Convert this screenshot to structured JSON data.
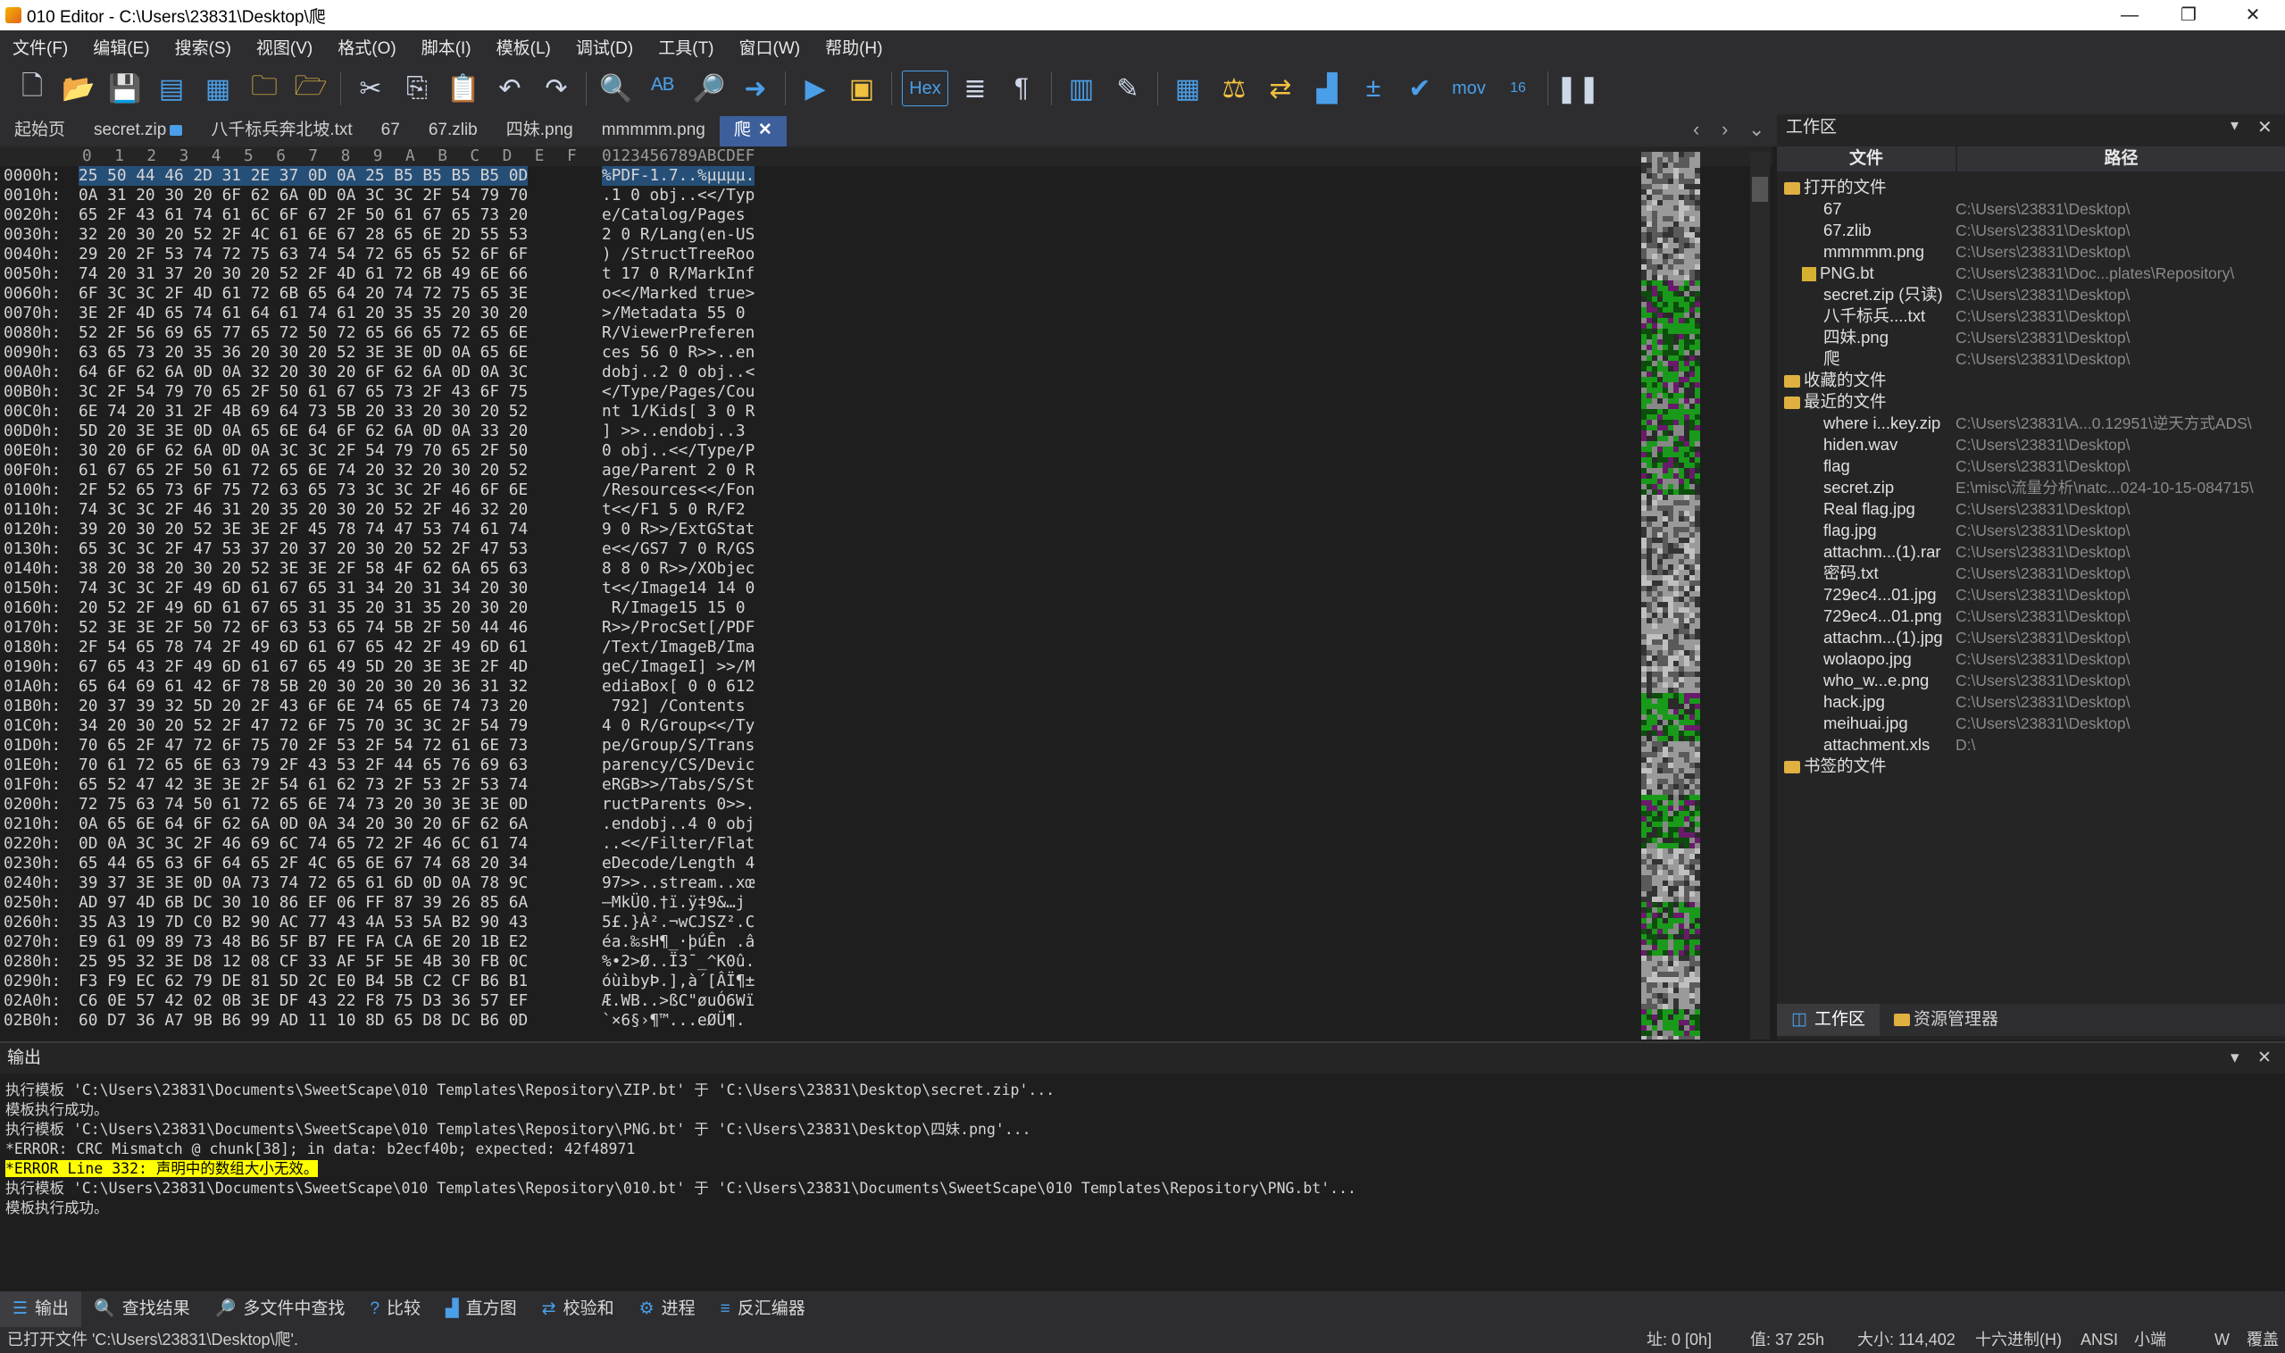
{
  "window": {
    "title": "010 Editor - C:\\Users\\23831\\Desktop\\爬",
    "min": "—",
    "max": "❐",
    "close": "✕"
  },
  "menu": [
    "文件(F)",
    "编辑(E)",
    "搜索(S)",
    "视图(V)",
    "格式(O)",
    "脚本(I)",
    "模板(L)",
    "调试(D)",
    "工具(T)",
    "窗口(W)",
    "帮助(H)"
  ],
  "toolbar": {
    "hex_label": "Hex",
    "mov_label": "mov",
    "base_label": "16"
  },
  "tabs": [
    {
      "label": "起始页"
    },
    {
      "label": "secret.zip",
      "locked": true
    },
    {
      "label": "八千标兵奔北坡.txt"
    },
    {
      "label": "67"
    },
    {
      "label": "67.zlib"
    },
    {
      "label": "四妹.png"
    },
    {
      "label": "mmmmm.png"
    },
    {
      "label": "爬",
      "active": true
    }
  ],
  "tab_close": "✕",
  "tab_nav": {
    "left": "‹",
    "right": "›",
    "menu": "⌄"
  },
  "hex": {
    "columns": [
      "0",
      "1",
      "2",
      "3",
      "4",
      "5",
      "6",
      "7",
      "8",
      "9",
      "A",
      "B",
      "C",
      "D",
      "E",
      "F"
    ],
    "text_header": "0123456789ABCDEF",
    "rows": [
      {
        "addr": "0000h:",
        "bytes": "25 50 44 46 2D 31 2E 37 0D 0A 25 B5 B5 B5 B5 0D",
        "text": "%PDF-1.7..%µµµµ."
      },
      {
        "addr": "0010h:",
        "bytes": "0A 31 20 30 20 6F 62 6A 0D 0A 3C 3C 2F 54 79 70",
        "text": ".1 0 obj..<</Typ"
      },
      {
        "addr": "0020h:",
        "bytes": "65 2F 43 61 74 61 6C 6F 67 2F 50 61 67 65 73 20",
        "text": "e/Catalog/Pages "
      },
      {
        "addr": "0030h:",
        "bytes": "32 20 30 20 52 2F 4C 61 6E 67 28 65 6E 2D 55 53",
        "text": "2 0 R/Lang(en-US"
      },
      {
        "addr": "0040h:",
        "bytes": "29 20 2F 53 74 72 75 63 74 54 72 65 65 52 6F 6F",
        "text": ") /StructTreeRoo"
      },
      {
        "addr": "0050h:",
        "bytes": "74 20 31 37 20 30 20 52 2F 4D 61 72 6B 49 6E 66",
        "text": "t 17 0 R/MarkInf"
      },
      {
        "addr": "0060h:",
        "bytes": "6F 3C 3C 2F 4D 61 72 6B 65 64 20 74 72 75 65 3E",
        "text": "o<</Marked true>"
      },
      {
        "addr": "0070h:",
        "bytes": "3E 2F 4D 65 74 61 64 61 74 61 20 35 35 20 30 20",
        "text": ">/Metadata 55 0 "
      },
      {
        "addr": "0080h:",
        "bytes": "52 2F 56 69 65 77 65 72 50 72 65 66 65 72 65 6E",
        "text": "R/ViewerPreferen"
      },
      {
        "addr": "0090h:",
        "bytes": "63 65 73 20 35 36 20 30 20 52 3E 3E 0D 0A 65 6E",
        "text": "ces 56 0 R>>..en"
      },
      {
        "addr": "00A0h:",
        "bytes": "64 6F 62 6A 0D 0A 32 20 30 20 6F 62 6A 0D 0A 3C",
        "text": "dobj..2 0 obj..<"
      },
      {
        "addr": "00B0h:",
        "bytes": "3C 2F 54 79 70 65 2F 50 61 67 65 73 2F 43 6F 75",
        "text": "</Type/Pages/Cou"
      },
      {
        "addr": "00C0h:",
        "bytes": "6E 74 20 31 2F 4B 69 64 73 5B 20 33 20 30 20 52",
        "text": "nt 1/Kids[ 3 0 R"
      },
      {
        "addr": "00D0h:",
        "bytes": "5D 20 3E 3E 0D 0A 65 6E 64 6F 62 6A 0D 0A 33 20",
        "text": "] >>..endobj..3 "
      },
      {
        "addr": "00E0h:",
        "bytes": "30 20 6F 62 6A 0D 0A 3C 3C 2F 54 79 70 65 2F 50",
        "text": "0 obj..<</Type/P"
      },
      {
        "addr": "00F0h:",
        "bytes": "61 67 65 2F 50 61 72 65 6E 74 20 32 20 30 20 52",
        "text": "age/Parent 2 0 R"
      },
      {
        "addr": "0100h:",
        "bytes": "2F 52 65 73 6F 75 72 63 65 73 3C 3C 2F 46 6F 6E",
        "text": "/Resources<</Fon"
      },
      {
        "addr": "0110h:",
        "bytes": "74 3C 3C 2F 46 31 20 35 20 30 20 52 2F 46 32 20",
        "text": "t<</F1 5 0 R/F2 "
      },
      {
        "addr": "0120h:",
        "bytes": "39 20 30 20 52 3E 3E 2F 45 78 74 47 53 74 61 74",
        "text": "9 0 R>>/ExtGStat"
      },
      {
        "addr": "0130h:",
        "bytes": "65 3C 3C 2F 47 53 37 20 37 20 30 20 52 2F 47 53",
        "text": "e<</GS7 7 0 R/GS"
      },
      {
        "addr": "0140h:",
        "bytes": "38 20 38 20 30 20 52 3E 3E 2F 58 4F 62 6A 65 63",
        "text": "8 8 0 R>>/XObjec"
      },
      {
        "addr": "0150h:",
        "bytes": "74 3C 3C 2F 49 6D 61 67 65 31 34 20 31 34 20 30",
        "text": "t<</Image14 14 0"
      },
      {
        "addr": "0160h:",
        "bytes": "20 52 2F 49 6D 61 67 65 31 35 20 31 35 20 30 20",
        "text": " R/Image15 15 0 "
      },
      {
        "addr": "0170h:",
        "bytes": "52 3E 3E 2F 50 72 6F 63 53 65 74 5B 2F 50 44 46",
        "text": "R>>/ProcSet[/PDF"
      },
      {
        "addr": "0180h:",
        "bytes": "2F 54 65 78 74 2F 49 6D 61 67 65 42 2F 49 6D 61",
        "text": "/Text/ImageB/Ima"
      },
      {
        "addr": "0190h:",
        "bytes": "67 65 43 2F 49 6D 61 67 65 49 5D 20 3E 3E 2F 4D",
        "text": "geC/ImageI] >>/M"
      },
      {
        "addr": "01A0h:",
        "bytes": "65 64 69 61 42 6F 78 5B 20 30 20 30 20 36 31 32",
        "text": "ediaBox[ 0 0 612"
      },
      {
        "addr": "01B0h:",
        "bytes": "20 37 39 32 5D 20 2F 43 6F 6E 74 65 6E 74 73 20",
        "text": " 792] /Contents "
      },
      {
        "addr": "01C0h:",
        "bytes": "34 20 30 20 52 2F 47 72 6F 75 70 3C 3C 2F 54 79",
        "text": "4 0 R/Group<</Ty"
      },
      {
        "addr": "01D0h:",
        "bytes": "70 65 2F 47 72 6F 75 70 2F 53 2F 54 72 61 6E 73",
        "text": "pe/Group/S/Trans"
      },
      {
        "addr": "01E0h:",
        "bytes": "70 61 72 65 6E 63 79 2F 43 53 2F 44 65 76 69 63",
        "text": "parency/CS/Devic"
      },
      {
        "addr": "01F0h:",
        "bytes": "65 52 47 42 3E 3E 2F 54 61 62 73 2F 53 2F 53 74",
        "text": "eRGB>>/Tabs/S/St"
      },
      {
        "addr": "0200h:",
        "bytes": "72 75 63 74 50 61 72 65 6E 74 73 20 30 3E 3E 0D",
        "text": "ructParents 0>>."
      },
      {
        "addr": "0210h:",
        "bytes": "0A 65 6E 64 6F 62 6A 0D 0A 34 20 30 20 6F 62 6A",
        "text": ".endobj..4 0 obj"
      },
      {
        "addr": "0220h:",
        "bytes": "0D 0A 3C 3C 2F 46 69 6C 74 65 72 2F 46 6C 61 74",
        "text": "..<</Filter/Flat"
      },
      {
        "addr": "0230h:",
        "bytes": "65 44 65 63 6F 64 65 2F 4C 65 6E 67 74 68 20 34",
        "text": "eDecode/Length 4"
      },
      {
        "addr": "0240h:",
        "bytes": "39 37 3E 3E 0D 0A 73 74 72 65 61 6D 0D 0A 78 9C",
        "text": "97>>..stream..xœ"
      },
      {
        "addr": "0250h:",
        "bytes": "AD 97 4D 6B DC 30 10 86 EF 06 FF 87 39 26 85 6A",
        "text": "­—MkÜ0.†ï.ÿ‡9&…j"
      },
      {
        "addr": "0260h:",
        "bytes": "35 A3 19 7D C0 B2 90 AC 77 43 4A 53 5A B2 90 43",
        "text": "5£.}À².¬wCJSZ².C"
      },
      {
        "addr": "0270h:",
        "bytes": "E9 61 09 89 73 48 B6 5F B7 FE FA CA 6E 20 1B E2",
        "text": "éa.‰sH¶_·þúÊn .â"
      },
      {
        "addr": "0280h:",
        "bytes": "25 95 32 3E D8 12 08 CF 33 AF 5F 5E 4B 30 FB 0C",
        "text": "%•2>Ø..Ï3¯_^K0û."
      },
      {
        "addr": "0290h:",
        "bytes": "F3 F9 EC 62 79 DE 81 5D 2C E0 B4 5B C2 CF B6 B1",
        "text": "óùìbyÞ.],à´[ÂÏ¶±"
      },
      {
        "addr": "02A0h:",
        "bytes": "C6 0E 57 42 02 0B 3E DF 43 22 F8 75 D3 36 57 EF",
        "text": "Æ.WB..>ßC\"øuÓ6Wï"
      },
      {
        "addr": "02B0h:",
        "bytes": "60 D7 36 A7 9B B6 99 AD 11 10 8D 65 D8 DC B6 0D",
        "text": "`×6§›¶™­...eØÜ¶."
      }
    ]
  },
  "workspace": {
    "title": "工作区",
    "col_file": "文件",
    "col_path": "路径",
    "groups": [
      {
        "label": "打开的文件",
        "items": [
          {
            "name": "67",
            "path": "C:\\Users\\23831\\Desktop\\"
          },
          {
            "name": "67.zlib",
            "path": "C:\\Users\\23831\\Desktop\\"
          },
          {
            "name": "mmmmm.png",
            "path": "C:\\Users\\23831\\Desktop\\"
          },
          {
            "name": "PNG.bt",
            "path": "C:\\Users\\23831\\Doc...plates\\Repository\\",
            "template": true
          },
          {
            "name": "secret.zip (只读)",
            "path": "C:\\Users\\23831\\Desktop\\"
          },
          {
            "name": "八千标兵....txt",
            "path": "C:\\Users\\23831\\Desktop\\"
          },
          {
            "name": "四妹.png",
            "path": "C:\\Users\\23831\\Desktop\\"
          },
          {
            "name": "爬",
            "path": "C:\\Users\\23831\\Desktop\\"
          }
        ]
      },
      {
        "label": "收藏的文件",
        "items": []
      },
      {
        "label": "最近的文件",
        "items": [
          {
            "name": "where i...key.zip",
            "path": "C:\\Users\\23831\\A...0.12951\\逆天方式ADS\\"
          },
          {
            "name": "hiden.wav",
            "path": "C:\\Users\\23831\\Desktop\\"
          },
          {
            "name": "flag",
            "path": "C:\\Users\\23831\\Desktop\\"
          },
          {
            "name": "secret.zip",
            "path": "E:\\misc\\流量分析\\natc...024-10-15-084715\\"
          },
          {
            "name": "Real flag.jpg",
            "path": "C:\\Users\\23831\\Desktop\\"
          },
          {
            "name": "flag.jpg",
            "path": "C:\\Users\\23831\\Desktop\\"
          },
          {
            "name": "attachm...(1).rar",
            "path": "C:\\Users\\23831\\Desktop\\"
          },
          {
            "name": "密码.txt",
            "path": "C:\\Users\\23831\\Desktop\\"
          },
          {
            "name": "729ec4...01.jpg",
            "path": "C:\\Users\\23831\\Desktop\\"
          },
          {
            "name": "729ec4...01.png",
            "path": "C:\\Users\\23831\\Desktop\\"
          },
          {
            "name": "attachm...(1).jpg",
            "path": "C:\\Users\\23831\\Desktop\\"
          },
          {
            "name": "wolaopo.jpg",
            "path": "C:\\Users\\23831\\Desktop\\"
          },
          {
            "name": "who_w...e.png",
            "path": "C:\\Users\\23831\\Desktop\\"
          },
          {
            "name": "hack.jpg",
            "path": "C:\\Users\\23831\\Desktop\\"
          },
          {
            "name": "meihuai.jpg",
            "path": "C:\\Users\\23831\\Desktop\\"
          },
          {
            "name": "attachment.xls",
            "path": "D:\\"
          }
        ]
      },
      {
        "label": "书签的文件",
        "items": []
      }
    ],
    "tab_workspace": "工作区",
    "tab_explorer": "资源管理器"
  },
  "output": {
    "title": "输出",
    "lines": [
      {
        "text": "执行模板 'C:\\Users\\23831\\Documents\\SweetScape\\010 Templates\\Repository\\ZIP.bt' 于 'C:\\Users\\23831\\Desktop\\secret.zip'..."
      },
      {
        "text": "模板执行成功。"
      },
      {
        "text": "执行模板 'C:\\Users\\23831\\Documents\\SweetScape\\010 Templates\\Repository\\PNG.bt' 于 'C:\\Users\\23831\\Desktop\\四妹.png'..."
      },
      {
        "text": "*ERROR: CRC Mismatch @ chunk[38]; in data: b2ecf40b; expected: 42f48971"
      },
      {
        "text": "*ERROR Line 332: 声明中的数组大小无效。",
        "error": true
      },
      {
        "text": "执行模板 'C:\\Users\\23831\\Documents\\SweetScape\\010 Templates\\Repository\\010.bt' 于 'C:\\Users\\23831\\Documents\\SweetScape\\010 Templates\\Repository\\PNG.bt'..."
      },
      {
        "text": "模板执行成功。"
      }
    ]
  },
  "bottom_tabs": [
    {
      "label": "输出",
      "icon": "output-icon",
      "glyph": "☰",
      "active": true
    },
    {
      "label": "查找结果",
      "icon": "search-icon",
      "glyph": "🔍"
    },
    {
      "label": "多文件中查找",
      "icon": "multi-search-icon",
      "glyph": "🔎"
    },
    {
      "label": "比较",
      "icon": "compare-icon",
      "glyph": "?"
    },
    {
      "label": "直方图",
      "icon": "histogram-icon",
      "glyph": "▟"
    },
    {
      "label": "校验和",
      "icon": "checksum-icon",
      "glyph": "⇄"
    },
    {
      "label": "进程",
      "icon": "process-icon",
      "glyph": "⚙"
    },
    {
      "label": "反汇编器",
      "icon": "disassembler-icon",
      "glyph": "≡"
    }
  ],
  "status": {
    "message": "已打开文件 'C:\\Users\\23831\\Desktop\\爬'.",
    "address": "址: 0 [0h]",
    "value": "值: 37 25h",
    "size": "大小: 114,402",
    "mode": "十六进制(H)",
    "encoding": "ANSI",
    "endian": "小端",
    "insert": "W",
    "overwrite": "覆盖"
  },
  "colors": {
    "accent": "#3d5f9c",
    "selection": "#264f78",
    "error_bg": "#ffff00",
    "folder": "#e0b040",
    "icon_blue": "#4a9fe8"
  }
}
